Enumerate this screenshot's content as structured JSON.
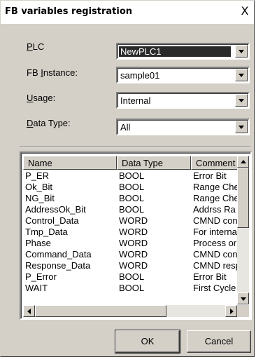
{
  "dialog": {
    "title": "FB variables registration",
    "close_glyph": "X"
  },
  "fields": {
    "plc": {
      "label_key": "P",
      "label_rest": "LC",
      "value": "NewPLC1"
    },
    "fb_instance": {
      "label_pre": "FB ",
      "label_key": "I",
      "label_rest": "nstance:",
      "value": "sample01"
    },
    "usage": {
      "label_key": "U",
      "label_rest": "sage:",
      "value": "Internal"
    },
    "data_type": {
      "label_key": "D",
      "label_rest": "ata Type:",
      "value": "All"
    }
  },
  "list": {
    "columns": [
      "Name",
      "Data Type",
      "Comment"
    ],
    "rows": [
      [
        "P_ER",
        "BOOL",
        "Error Bit"
      ],
      [
        "Ok_Bit",
        "BOOL",
        "Range Che"
      ],
      [
        "NG_Bit",
        "BOOL",
        "Range Che"
      ],
      [
        "AddressOk_Bit",
        "BOOL",
        "Addrss Ra"
      ],
      [
        "Control_Data",
        "WORD",
        "CMND con"
      ],
      [
        "Tmp_Data",
        "WORD",
        "For interna"
      ],
      [
        "Phase",
        "WORD",
        "Process or"
      ],
      [
        "Command_Data",
        "WORD",
        "CMND con"
      ],
      [
        "Response_Data",
        "WORD",
        "CMND resp"
      ],
      [
        "P_Error",
        "BOOL",
        "Error Bit"
      ],
      [
        "WAIT",
        "BOOL",
        "First Cycle"
      ]
    ]
  },
  "buttons": {
    "ok": "OK",
    "cancel": "Cancel"
  },
  "icons": [
    "close-icon",
    "chevron-down-icon",
    "scroll-up-icon",
    "scroll-down-icon",
    "scroll-left-icon",
    "scroll-right-icon"
  ]
}
